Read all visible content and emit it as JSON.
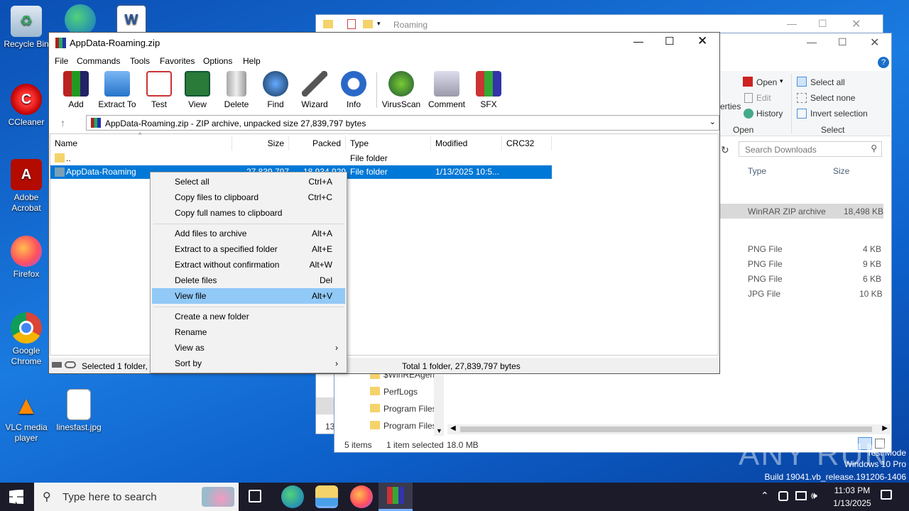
{
  "desktop": {
    "icons": [
      {
        "label": "Recycle Bin"
      },
      {
        "label": "CCleaner"
      },
      {
        "label": "Adobe Acrobat"
      },
      {
        "label": "Firefox"
      },
      {
        "label": "Google Chrome"
      },
      {
        "label": "VLC media player"
      },
      {
        "label": "linesfast.jpg"
      }
    ]
  },
  "explorer_back": {
    "title": "Roaming"
  },
  "explorer": {
    "ribbon": {
      "properties_fragment": "erties",
      "open_label": "Open",
      "edit_label": "Edit",
      "history_label": "History",
      "group_open": "Open",
      "select_all": "Select all",
      "select_none": "Select none",
      "invert_selection": "Invert selection",
      "group_select": "Select"
    },
    "search_placeholder": "Search Downloads",
    "columns": {
      "type": "Type",
      "size": "Size"
    },
    "rows": [
      {
        "type": "WinRAR ZIP archive",
        "size": "18,498 KB"
      },
      {
        "type": "PNG File",
        "size": "4 KB"
      },
      {
        "type": "PNG File",
        "size": "9 KB"
      },
      {
        "type": "PNG File",
        "size": "6 KB"
      },
      {
        "type": "JPG File",
        "size": "10 KB"
      }
    ],
    "tree": [
      "$WinREAgent",
      "PerfLogs",
      "Program Files",
      "Program Files"
    ],
    "tree_left_num": "13",
    "status": {
      "items": "5 items",
      "selected": "1 item selected",
      "size": "18.0 MB"
    }
  },
  "winrar": {
    "title": "AppData-Roaming.zip",
    "menu": [
      "File",
      "Commands",
      "Tools",
      "Favorites",
      "Options",
      "Help"
    ],
    "toolbar": [
      "Add",
      "Extract To",
      "Test",
      "View",
      "Delete",
      "Find",
      "Wizard",
      "Info",
      "VirusScan",
      "Comment",
      "SFX"
    ],
    "path": "AppData-Roaming.zip - ZIP archive, unpacked size 27,839,797 bytes",
    "columns": {
      "name": "Name",
      "size": "Size",
      "packed": "Packed",
      "type": "Type",
      "modified": "Modified",
      "crc": "CRC32"
    },
    "rows": [
      {
        "name": "..",
        "size": "",
        "packed": "",
        "type": "File folder",
        "modified": ""
      },
      {
        "name": "AppData-Roaming",
        "size": "27,839,797",
        "packed": "18,934,929",
        "type": "File folder",
        "modified": "1/13/2025 10:5..."
      }
    ],
    "status_left": "Selected 1 folder, 2",
    "status_right": "Total 1 folder, 27,839,797 bytes"
  },
  "context_menu": {
    "groups": [
      [
        {
          "label": "Select all",
          "acc": "Ctrl+A"
        },
        {
          "label": "Copy files to clipboard",
          "acc": "Ctrl+C"
        },
        {
          "label": "Copy full names to clipboard",
          "acc": ""
        }
      ],
      [
        {
          "label": "Add files to archive",
          "acc": "Alt+A"
        },
        {
          "label": "Extract to a specified folder",
          "acc": "Alt+E"
        },
        {
          "label": "Extract without confirmation",
          "acc": "Alt+W"
        },
        {
          "label": "Delete files",
          "acc": "Del"
        },
        {
          "label": "View file",
          "acc": "Alt+V"
        }
      ],
      [
        {
          "label": "Create a new folder",
          "acc": ""
        },
        {
          "label": "Rename",
          "acc": ""
        },
        {
          "label": "View as",
          "acc": "›"
        },
        {
          "label": "Sort by",
          "acc": "›"
        }
      ]
    ]
  },
  "watermark": {
    "brand": "ANY RUN",
    "mode": "Test Mode",
    "os": "Windows 10 Pro",
    "build": "Build 19041.vb_release.191206-1406"
  },
  "taskbar": {
    "search_placeholder": "Type here to search",
    "time": "11:03 PM",
    "date": "1/13/2025"
  },
  "colors": {
    "selection": "#0078d7",
    "menu_highlight": "#91c9f7",
    "taskbar": "#1b1b2a"
  }
}
